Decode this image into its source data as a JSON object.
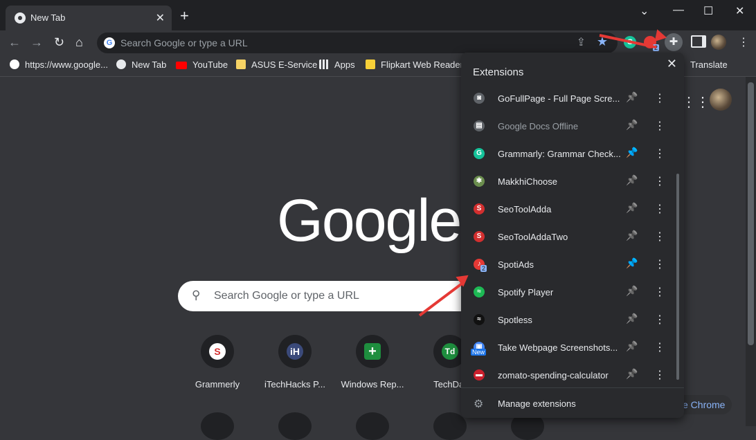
{
  "browser": {
    "tab_title": "New Tab",
    "omnibox_placeholder": "Search Google or type a URL",
    "badge_count": "2"
  },
  "bookmarks": [
    {
      "label": "https://www.google...",
      "icon": "google-icon"
    },
    {
      "label": "New Tab",
      "icon": "globe-icon"
    },
    {
      "label": "YouTube",
      "icon": "youtube-icon"
    },
    {
      "label": "ASUS E-Service",
      "icon": "folder-icon"
    },
    {
      "label": "Apps",
      "icon": "apps-icon"
    },
    {
      "label": "Flipkart Web Reader",
      "icon": "flipkart-icon"
    }
  ],
  "page": {
    "logo": "Google",
    "search_placeholder": "Search Google or type a URL",
    "translate_label": "Translate",
    "chrome_button": "e Chrome"
  },
  "shortcuts": [
    {
      "label": "Grammerly",
      "letter": "S",
      "color": "#d32f2f"
    },
    {
      "label": "iTechHacks P...",
      "letter": "iH",
      "color": "#3b4a7a"
    },
    {
      "label": "Windows Rep...",
      "letter": "+",
      "color": "#1e8e3e"
    },
    {
      "label": "TechDat",
      "letter": "Td",
      "color": "#1e8e3e"
    }
  ],
  "extensions_panel": {
    "title": "Extensions",
    "manage_label": "Manage extensions",
    "items": [
      {
        "name": "GoFullPage - Full Page Scre...",
        "icon": "camera-icon",
        "pinned": false,
        "dim": false,
        "color": "#5f6368",
        "glyph": "◙"
      },
      {
        "name": "Google Docs Offline",
        "icon": "docs-icon",
        "pinned": false,
        "dim": true,
        "color": "#5f6368",
        "glyph": "▤"
      },
      {
        "name": "Grammarly: Grammar Check...",
        "icon": "grammarly-icon",
        "pinned": true,
        "dim": false,
        "color": "#15c39a",
        "glyph": "G"
      },
      {
        "name": "MakkhiChoose",
        "icon": "fly-icon",
        "pinned": false,
        "dim": false,
        "color": "#6b8e4e",
        "glyph": "✱"
      },
      {
        "name": "SeoToolAdda",
        "icon": "seotool-icon",
        "pinned": false,
        "dim": false,
        "color": "#d32f2f",
        "glyph": "S"
      },
      {
        "name": "SeoToolAddaTwo",
        "icon": "seotool-icon",
        "pinned": false,
        "dim": false,
        "color": "#d32f2f",
        "glyph": "S"
      },
      {
        "name": "SpotiAds",
        "icon": "spotiads-icon",
        "pinned": true,
        "dim": false,
        "color": "#e53935",
        "glyph": "♪"
      },
      {
        "name": "Spotify Player",
        "icon": "spotify-icon",
        "pinned": false,
        "dim": false,
        "color": "#1db954",
        "glyph": "≈"
      },
      {
        "name": "Spotless",
        "icon": "spotless-icon",
        "pinned": false,
        "dim": false,
        "color": "#111111",
        "glyph": "≈"
      },
      {
        "name": "Take Webpage Screenshots...",
        "icon": "screenshot-icon",
        "pinned": false,
        "dim": false,
        "color": "#4285f4",
        "glyph": "▣"
      },
      {
        "name": "zomato-spending-calculator",
        "icon": "zomato-icon",
        "pinned": false,
        "dim": false,
        "color": "#cb202d",
        "glyph": "▬"
      }
    ]
  },
  "badges": {
    "new_label": "New",
    "spotiads_count": "2"
  }
}
